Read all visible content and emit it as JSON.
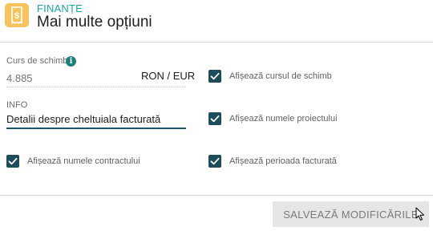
{
  "header": {
    "section": "FINANȚE",
    "title": "Mai multe opțiuni",
    "icon": "receipt-dollar-icon",
    "icon_color": "#f7c35c",
    "accent_color": "#1aa7a0"
  },
  "exchange_rate": {
    "label": "Curs de schimb",
    "placeholder": "4.885",
    "unit": "RON / EUR",
    "info_icon": "i"
  },
  "info_field": {
    "label": "INFO",
    "value": "Detalii despre cheltuiala facturată",
    "underline_color": "#18566a"
  },
  "options": [
    {
      "label": "Afișează cursul de schimb",
      "checked": true
    },
    {
      "label": "Afișează numele proiectului",
      "checked": true
    },
    {
      "label": "Afișează numele contractului",
      "checked": true
    },
    {
      "label": "Afișează perioada facturată",
      "checked": true
    }
  ],
  "checkbox_color": "#1d4d5a",
  "footer": {
    "save_label": "SALVEAZĂ MODIFICĂRILE"
  }
}
